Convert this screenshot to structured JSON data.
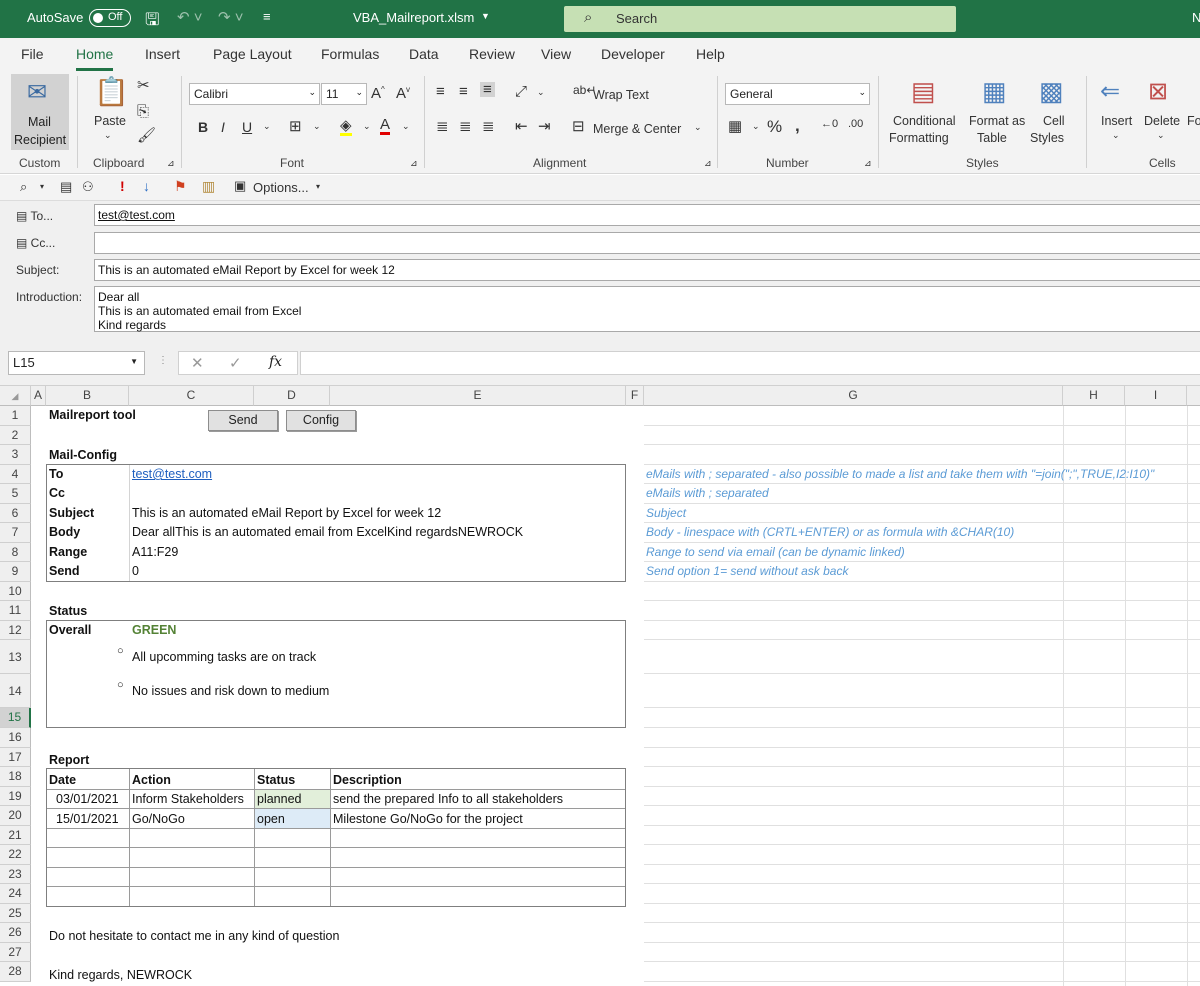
{
  "titlebar": {
    "autosave": "AutoSave",
    "toggle": "Off",
    "filename": "VBA_Mailreport.xlsm",
    "search": "Search",
    "user_initial": "N"
  },
  "tabs": [
    "File",
    "Home",
    "Insert",
    "Page Layout",
    "Formulas",
    "Data",
    "Review",
    "View",
    "Developer",
    "Help"
  ],
  "ribbon": {
    "mail_recipient": "Mail Recipient",
    "mail_line1": "Mail",
    "mail_line2": "Recipient",
    "groups": {
      "custom": "Custom",
      "clipboard": "Clipboard",
      "font": "Font",
      "alignment": "Alignment",
      "number": "Number",
      "styles": "Styles",
      "cells": "Cells"
    },
    "paste": "Paste",
    "font_name": "Calibri",
    "font_size": "11",
    "wrap_text": "Wrap Text",
    "merge_center": "Merge & Center",
    "number_format": "General",
    "conditional_1": "Conditional",
    "conditional_2": "Formatting",
    "format_table_1": "Format as",
    "format_table_2": "Table",
    "cell_styles_1": "Cell",
    "cell_styles_2": "Styles",
    "insert": "Insert",
    "delete": "Delete",
    "format_short": "Fo"
  },
  "qat": {
    "options": "Options..."
  },
  "envelope": {
    "to_label": "To...",
    "cc_label": "Cc...",
    "subject_label": "Subject:",
    "intro_label": "Introduction:",
    "to_value": "test@test.com",
    "cc_value": "",
    "subject_value": "This is an automated eMail Report by Excel for week 12",
    "intro_line1": "Dear all",
    "intro_line2": "This is an automated email from Excel",
    "intro_line3": "Kind regards"
  },
  "formula_bar": {
    "name_box": "L15",
    "formula": ""
  },
  "columns": [
    "A",
    "B",
    "C",
    "D",
    "E",
    "F",
    "G",
    "H",
    "I"
  ],
  "rows": [
    "1",
    "2",
    "3",
    "4",
    "5",
    "6",
    "7",
    "8",
    "9",
    "10",
    "11",
    "12",
    "13",
    "14",
    "15",
    "16",
    "17",
    "18",
    "19",
    "20",
    "21",
    "22",
    "23",
    "24",
    "25",
    "26",
    "27",
    "28"
  ],
  "sheet": {
    "title": "Mailreport tool",
    "send_btn": "Send",
    "config_btn": "Config",
    "mail_config": "Mail-Config",
    "config": [
      {
        "key": "To",
        "value": "test@test.com",
        "note": "eMails with ; separated - also possible to made a list and take them with \"=join(\";\",TRUE,I2:I10)\""
      },
      {
        "key": "Cc",
        "value": "",
        "note": "eMails with ; separated"
      },
      {
        "key": "Subject",
        "value": "This is an automated eMail Report by Excel for week 12",
        "note": "Subject"
      },
      {
        "key": "Body",
        "value": "Dear allThis is an automated email from ExcelKind regardsNEWROCK",
        "note": "Body - linespace with (CRTL+ENTER) or as formula with &CHAR(10)"
      },
      {
        "key": "Range",
        "value": "A11:F29",
        "note": "Range to send via email (can be dynamic linked)"
      },
      {
        "key": "Send",
        "value": "0",
        "note": "Send option 1= send without ask back"
      }
    ],
    "status_title": "Status",
    "overall_label": "Overall",
    "overall_value": "GREEN",
    "bullets": [
      "All upcomming tasks are on track",
      "No issues and risk down to medium"
    ],
    "report_title": "Report",
    "report_headers": [
      "Date",
      "Action",
      "Status",
      "Description"
    ],
    "report_rows": [
      {
        "date": "03/01/2021",
        "action": "Inform Stakeholders",
        "status": "planned",
        "description": "send the prepared Info to all stakeholders"
      },
      {
        "date": "15/01/2021",
        "action": "Go/NoGo",
        "status": "open",
        "description": "Milestone Go/NoGo for the project"
      }
    ],
    "closing_1": "Do not hesitate to contact me in any kind of question",
    "closing_2": "Kind regards, NEWROCK"
  },
  "colors": {
    "excel_green": "#217346",
    "planned_fill": "#e2efda",
    "open_fill": "#ddebf7",
    "note_blue": "#5b9bd5",
    "green_text": "#548235"
  }
}
